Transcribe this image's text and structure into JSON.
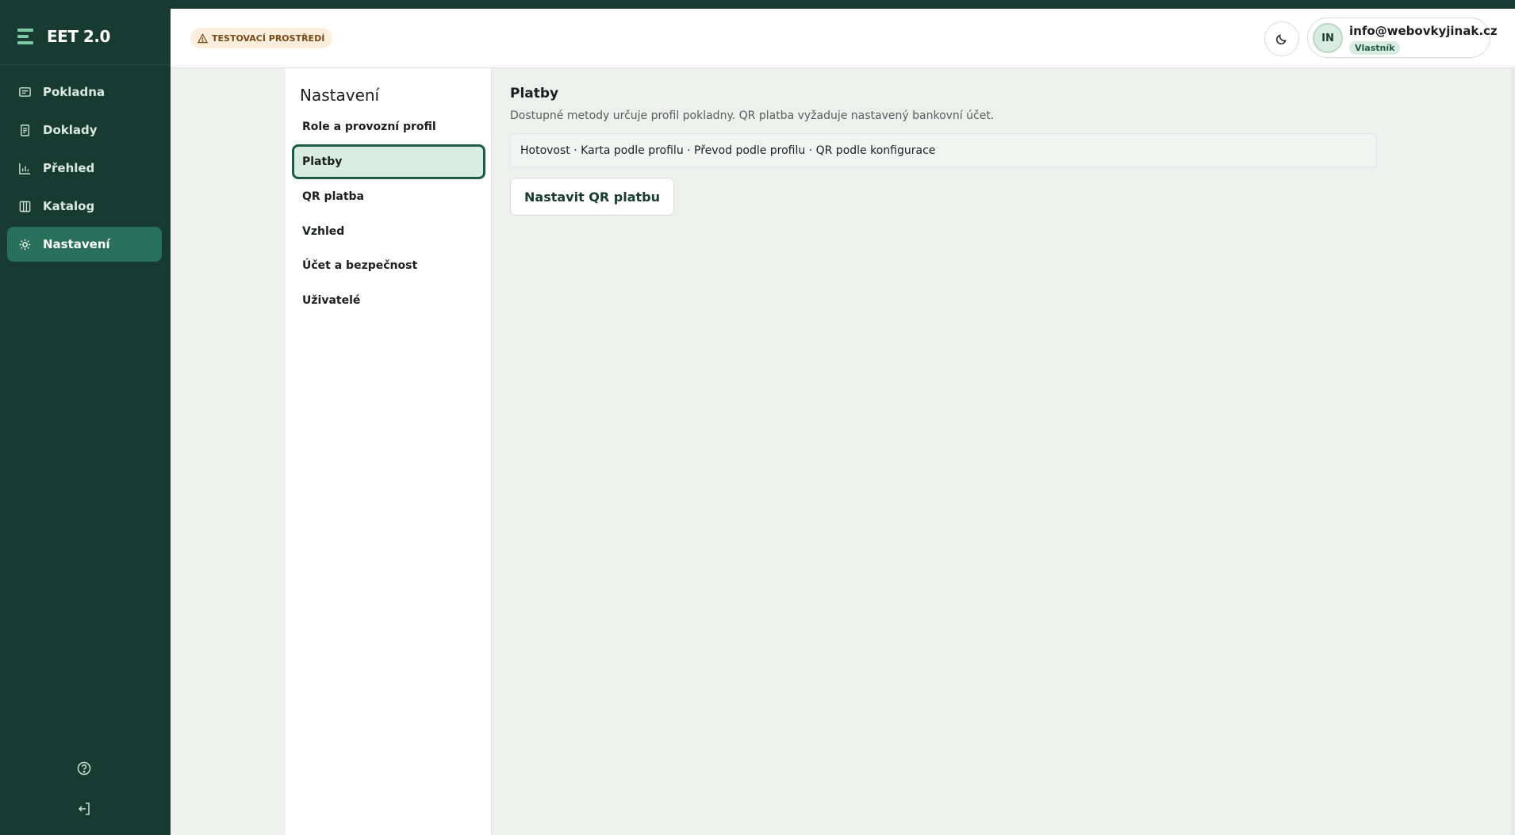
{
  "app": {
    "title": "EET 2.0"
  },
  "sidebar": {
    "items": [
      {
        "label": "Pokladna",
        "icon": "receipt-icon"
      },
      {
        "label": "Doklady",
        "icon": "document-icon"
      },
      {
        "label": "Přehled",
        "icon": "bar-chart-icon"
      },
      {
        "label": "Katalog",
        "icon": "book-icon"
      },
      {
        "label": "Nastavení",
        "icon": "gear-icon",
        "active": true
      }
    ],
    "bottom_icons": [
      "help-icon",
      "logout-icon"
    ]
  },
  "header": {
    "env_badge": "TESTOVACÍ PROSTŘEDÍ",
    "user": {
      "initials": "IN",
      "email": "info@webovkyjinak.cz",
      "role": "Vlastník"
    }
  },
  "settings": {
    "title": "Nastavení",
    "items": [
      {
        "label": "Role a provozní profil"
      },
      {
        "label": "Platby",
        "active": true
      },
      {
        "label": "QR platba"
      },
      {
        "label": "Vzhled"
      },
      {
        "label": "Účet a bezpečnost"
      },
      {
        "label": "Uživatelé"
      }
    ]
  },
  "content": {
    "title": "Platby",
    "description": "Dostupné metody určuje profil pokladny. QR platba vyžaduje nastavený bankovní účet.",
    "methods": "Hotovost · Karta podle profilu · Převod podle profilu · QR podle konfigurace",
    "button_label": "Nastavit QR platbu"
  },
  "colors": {
    "sidebar_bg": "#173b30",
    "accent": "#28705a",
    "active_tint": "#d9ece1"
  }
}
